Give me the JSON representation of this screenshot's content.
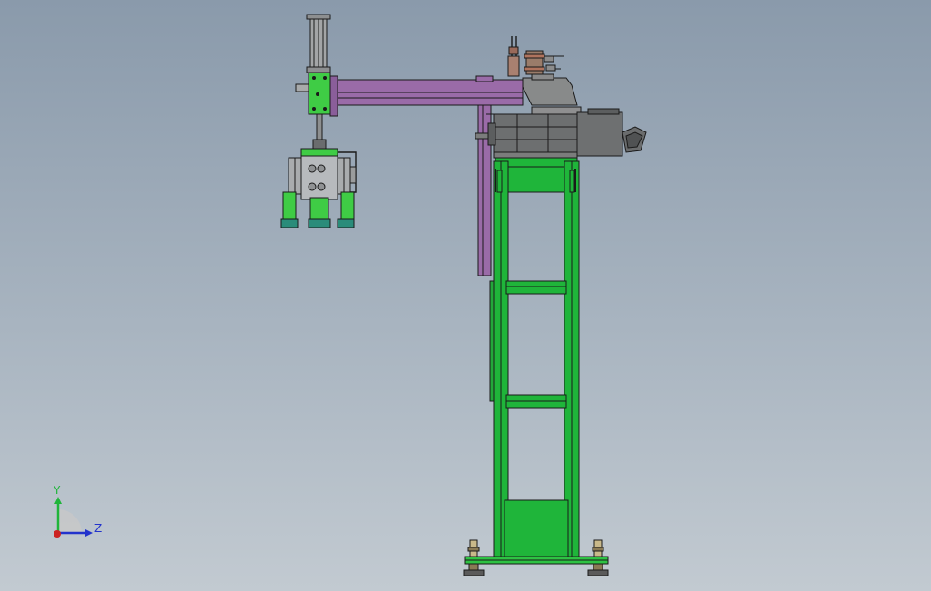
{
  "viewport": {
    "background_top": "#8a9aab",
    "background_bottom": "#c2cad1"
  },
  "model": {
    "frame_color": "#1fb53a",
    "arm_color": "#9a6ba8",
    "motor_color": "#6d6f70",
    "block_color": "#3fcc45",
    "gripper_body_color": "#b7babd",
    "gripper_pad_color": "#2a8c7a",
    "outline_color": "#1a1a1a"
  },
  "triad": {
    "y_label": "Y",
    "z_label": "Z",
    "y_color": "#1fb53a",
    "z_color": "#2233cc",
    "origin_color": "#cc2222"
  }
}
